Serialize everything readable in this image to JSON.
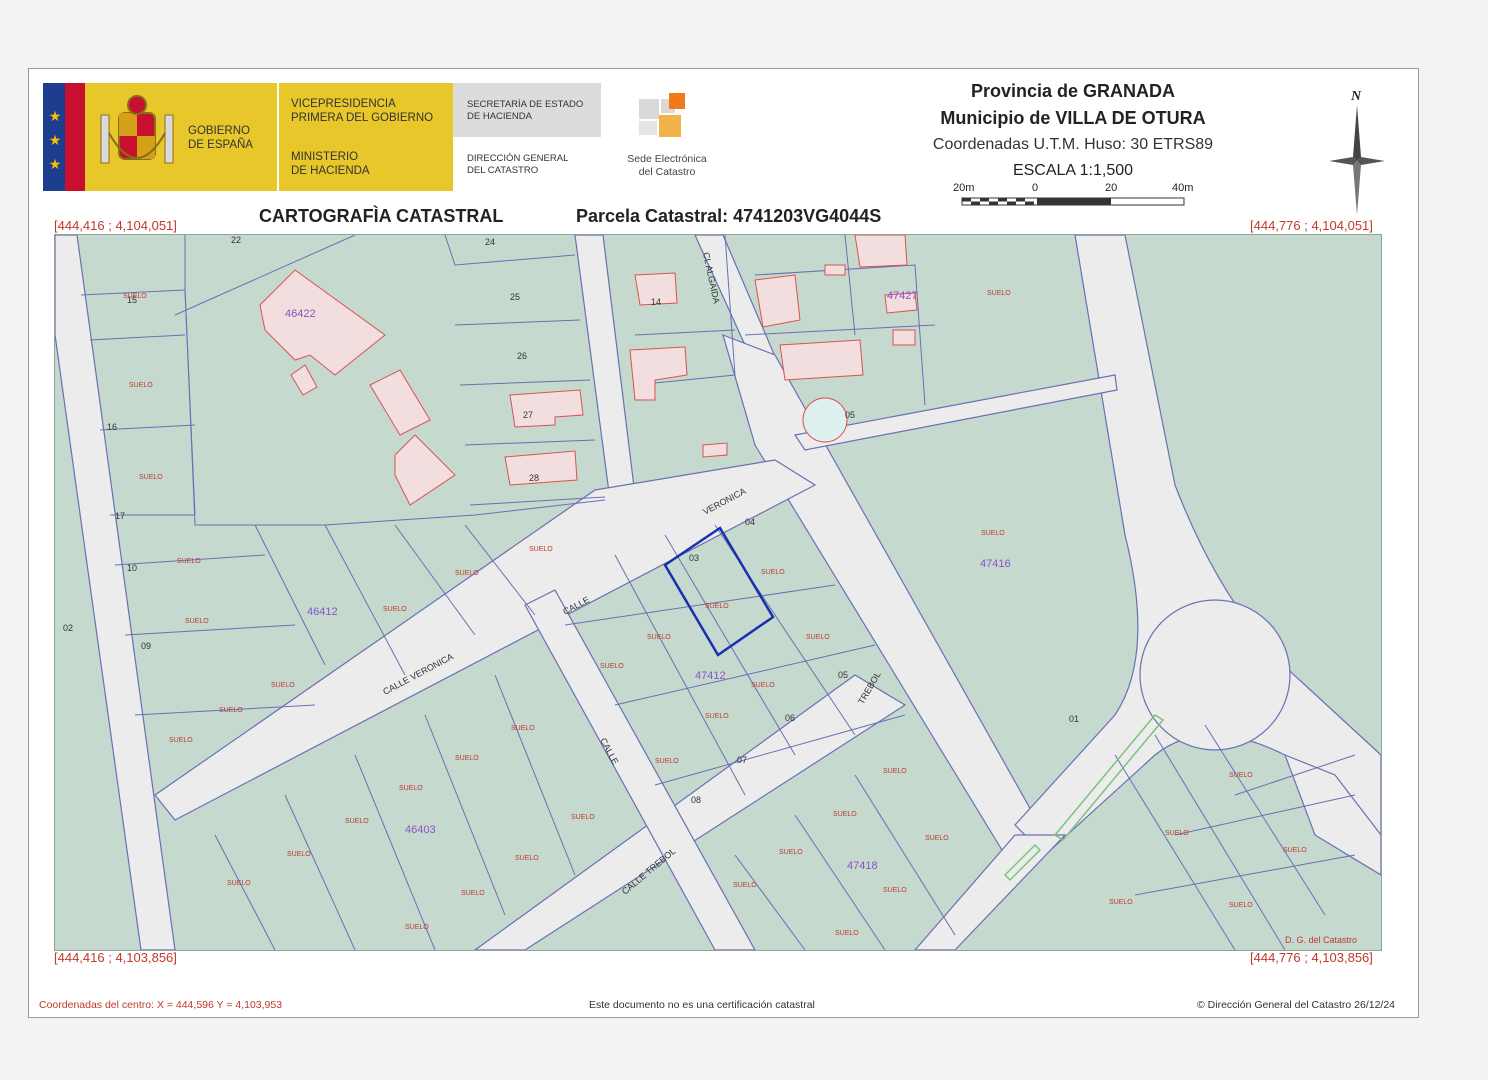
{
  "header": {
    "gov_line1": "GOBIERNO",
    "gov_line2": "DE ESPAÑA",
    "vice_line1": "VICEPRESIDENCIA",
    "vice_line2": "PRIMERA DEL GOBIERNO",
    "min_line1": "MINISTERIO",
    "min_line2": "DE HACIENDA",
    "sec_line1": "SECRETARÍA DE ESTADO",
    "sec_line2": "DE HACIENDA",
    "dg_line1": "DIRECCIÓN GENERAL",
    "dg_line2": "DEL CATASTRO",
    "sede_line1": "Sede Electrónica",
    "sede_line2": "del Catastro",
    "province": "Provincia de GRANADA",
    "municipality": "Municipio de VILLA DE OTURA",
    "coords_system": "Coordenadas U.T.M. Huso: 30 ETRS89",
    "scale": "ESCALA 1:1,500",
    "scale_ticks": [
      "20m",
      "0",
      "20",
      "40m"
    ],
    "north": "N",
    "cartography_title": "CARTOGRAFÌA CATASTRAL",
    "parcel": "Parcela Catastral: 4741203VG4044S"
  },
  "corners": {
    "top_left": "[444,416 ; 4,104,051]",
    "top_right": "[444,776 ; 4,104,051]",
    "bottom_left": "[444,416 ; 4,103,856]",
    "bottom_right": "[444,776 ; 4,103,856]"
  },
  "footer": {
    "center_coords": "Coordenadas del centro: X = 444,596 Y = 4,103,953",
    "disclaimer": "Este documento no es una certificación catastral",
    "copyright": "© Dirección General del Catastro 26/12/24"
  },
  "map": {
    "colors": {
      "parcel": "#c5d9cf",
      "road": "#ececec",
      "line": "#6b6fb3",
      "building": "#d9534f",
      "highlight": "#1a2fb0",
      "block_label": "#8a52c8"
    },
    "block_labels": [
      "46422",
      "46412",
      "46403",
      "47412",
      "47416",
      "47418",
      "47427"
    ],
    "street_names": [
      "VERONICA",
      "CALLE",
      "CL ALGAIDA",
      "TREBOL",
      "CALLE VERONICA",
      "CALLE TREBOL",
      "CALLE"
    ],
    "parcel_numbers": [
      "15",
      "16",
      "17",
      "22",
      "24",
      "25",
      "26",
      "27",
      "28",
      "02",
      "03",
      "04",
      "05",
      "06",
      "07",
      "08",
      "09",
      "10",
      "01",
      "14",
      "05"
    ],
    "soil_label": "SUELO",
    "watermark": "D. G. del Catastro"
  }
}
